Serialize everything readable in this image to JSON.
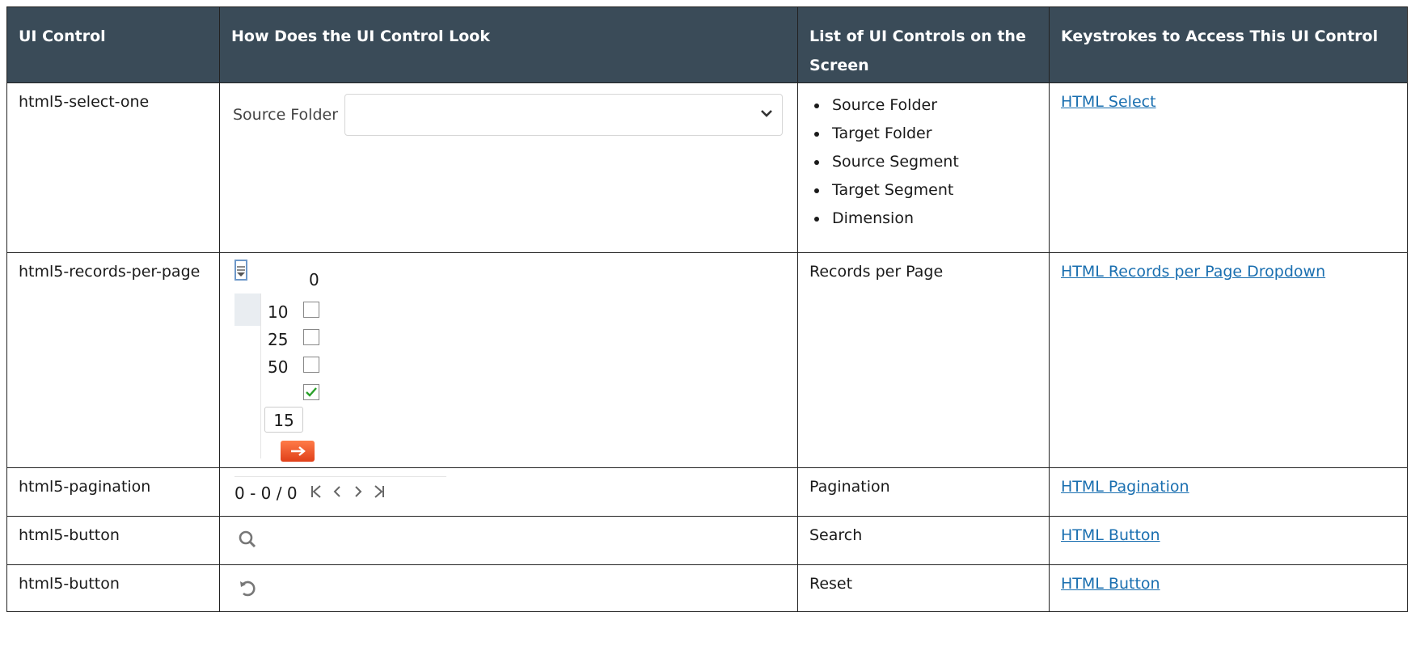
{
  "headers": {
    "ui_control": "UI Control",
    "look": "How Does the UI Control Look",
    "list": "List of UI Controls on the Screen",
    "keystrokes": "Keystrokes to Access This UI Control"
  },
  "rows": [
    {
      "control": "html5-select-one",
      "select_label": "Source Folder",
      "list": [
        "Source Folder",
        "Target Folder",
        "Source Segment",
        "Target Segment",
        "Dimension"
      ],
      "link": "HTML Select"
    },
    {
      "control": "html5-records-per-page",
      "record_count": "0",
      "options": [
        "10",
        "25",
        "50"
      ],
      "input_value": "15",
      "list": "Records per Page",
      "link": "HTML Records per Page Dropdown"
    },
    {
      "control": "html5-pagination",
      "range_text": "0 - 0 / 0",
      "list": "Pagination",
      "link": "HTML Pagination"
    },
    {
      "control": "html5-button",
      "icon": "search-icon",
      "list": "Search",
      "link": "HTML Button"
    },
    {
      "control": "html5-button",
      "icon": "reset-icon",
      "list": "Reset",
      "link": "HTML Button"
    }
  ],
  "colors": {
    "header_bg": "#3a4b58",
    "link": "#1a6fb0",
    "go_button": "#f0582a",
    "checkmark": "#2aa02a"
  }
}
